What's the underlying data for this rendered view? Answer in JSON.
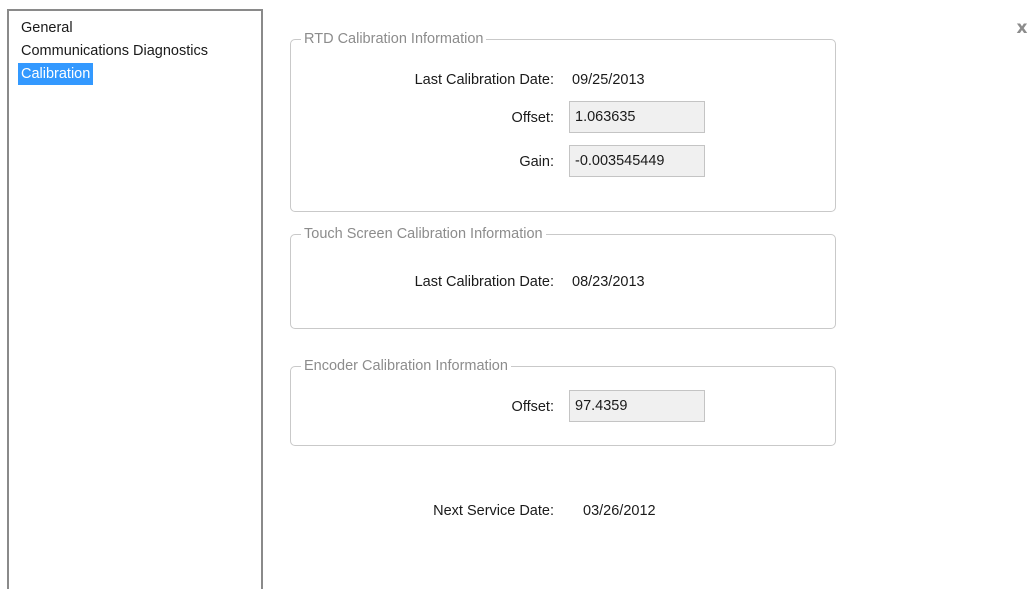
{
  "nav": {
    "items": [
      {
        "label": "General"
      },
      {
        "label": "Communications Diagnostics"
      },
      {
        "label": "Calibration"
      }
    ],
    "selected": "Calibration"
  },
  "close_label": "x",
  "rtd": {
    "legend": "RTD Calibration Information",
    "last_cal_label": "Last Calibration Date:",
    "last_cal_value": "09/25/2013",
    "offset_label": "Offset:",
    "offset_value": "1.063635",
    "gain_label": "Gain:",
    "gain_value": "-0.003545449"
  },
  "touch": {
    "legend": "Touch Screen Calibration Information",
    "last_cal_label": "Last Calibration Date:",
    "last_cal_value": "08/23/2013"
  },
  "encoder": {
    "legend": "Encoder Calibration Information",
    "offset_label": "Offset:",
    "offset_value": "97.4359"
  },
  "service": {
    "next_label": "Next Service Date:",
    "next_value": "03/26/2012"
  },
  "colors": {
    "selection": "#3399ff",
    "legend_text": "#8c8c8c",
    "field_bg": "#f0f0f0",
    "nav_border": "#8a8a8a"
  }
}
